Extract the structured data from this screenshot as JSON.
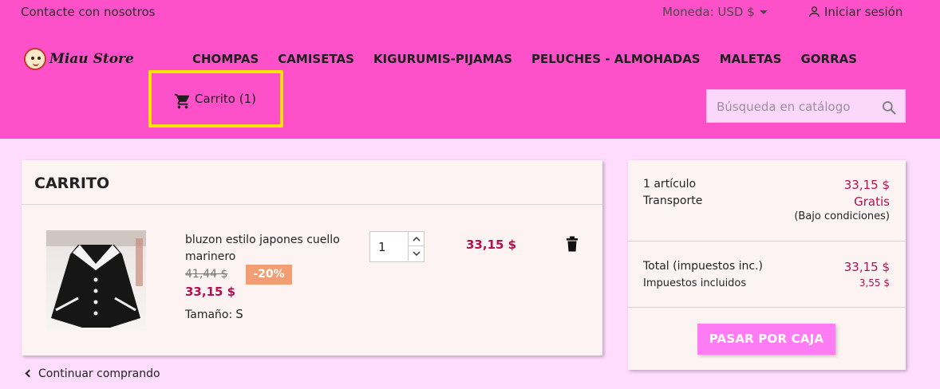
{
  "topbar": {
    "contact": "Contacte con nosotros",
    "currency": "Moneda: USD $",
    "login": "Iniciar sesión"
  },
  "header": {
    "logo_text": "Miau Store",
    "nav": [
      "CHOMPAS",
      "CAMISETAS",
      "KIGURUMIS-PIJAMAS",
      "PELUCHES - ALMOHADAS",
      "MALETAS",
      "GORRAS"
    ],
    "cart_label": "Carrito (1)",
    "search_placeholder": "Búsqueda en catálogo"
  },
  "cart": {
    "title": "CARRITO",
    "item": {
      "name": "bluzon estilo japones cuello marinero",
      "old_price": "41,44 $",
      "discount": "-20%",
      "price": "33,15 $",
      "size_label": "Tamaño:",
      "size_value": "S",
      "quantity": "1",
      "total": "33,15 $"
    },
    "continue_label": "Continuar comprando"
  },
  "summary": {
    "items_label": "1 artículo",
    "items_value": "33,15 $",
    "shipping_label": "Transporte",
    "shipping_value": "Gratis",
    "shipping_note": "(Bajo condiciones)",
    "total_label": "Total (impuestos inc.)",
    "total_value": "33,15 $",
    "tax_label": "Impuestos incluidos",
    "tax_value": "3,55 $",
    "checkout_label": "PASAR POR CAJA"
  },
  "colors": {
    "header_bg": "#fe51c9",
    "page_bg": "#fedcfe",
    "price": "#b40f4f",
    "discount_badge": "#f39d72",
    "checkout_button": "#ff7cf5",
    "highlight_box": "#ffe300"
  },
  "icons": [
    "user-icon",
    "caret-down-icon",
    "cart-icon",
    "search-icon",
    "trash-icon",
    "chevron-up-icon",
    "chevron-down-icon",
    "chevron-left-icon"
  ]
}
